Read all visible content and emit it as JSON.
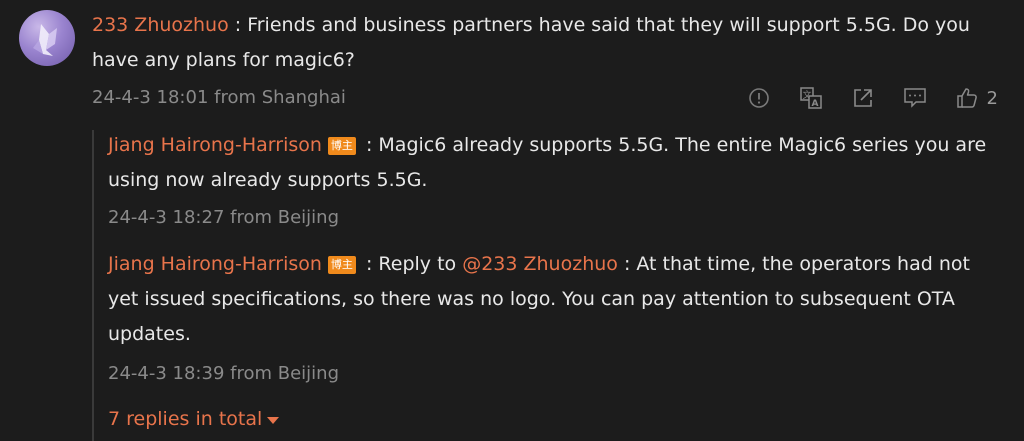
{
  "comment": {
    "username": "233 Zhuozhuo",
    "separator": " : ",
    "text": "Friends and business partners have said that they will support 5.5G. Do you have any plans for magic6?",
    "date": "24-4-3 18:01",
    "location": "from Shanghai",
    "like_count": "2",
    "icons": {
      "report": "report-icon",
      "translate": "translate-icon",
      "share": "share-icon",
      "reply": "reply-icon",
      "like": "thumbs-up-icon"
    }
  },
  "replies": [
    {
      "username": "Jiang Hairong-Harrison",
      "badge": "博主",
      "separator": " : ",
      "text": "Magic6 already supports 5.5G. The entire Magic6 series you are using now already supports 5.5G.",
      "date": "24-4-3 18:27",
      "location": "from Beijing"
    },
    {
      "username": "Jiang Hairong-Harrison",
      "badge": "博主",
      "separator": " : ",
      "reply_to_prefix": "Reply to ",
      "reply_to_user": "@233 Zhuozhuo",
      "separator2": " : ",
      "text": "At that time, the operators had not yet issued specifications, so there was no logo. You can pay attention to subsequent OTA updates.",
      "date": "24-4-3 18:39",
      "location": "from Beijing"
    }
  ],
  "total_replies": "7 replies in total",
  "colors": {
    "username": "#e8744b",
    "badge": "#f08a1c",
    "meta": "#8a8a8a",
    "background": "#1c1c1c"
  }
}
